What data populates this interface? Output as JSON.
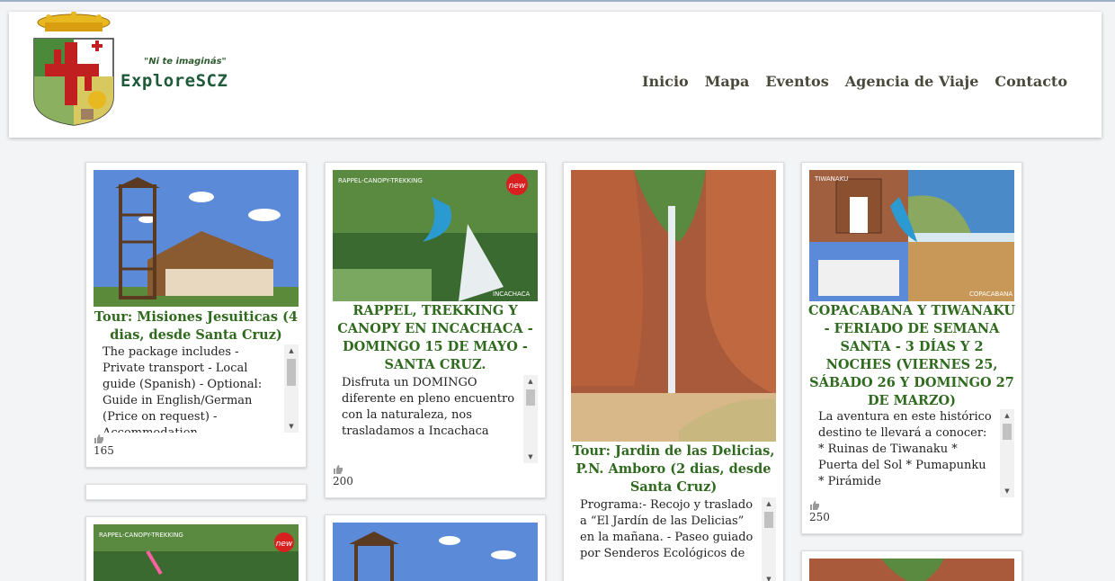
{
  "header": {
    "tagline": "\"Ni te imaginás\"",
    "brand": "ExploreSCZ",
    "nav": [
      "Inicio",
      "Mapa",
      "Eventos",
      "Agencia de Viaje",
      "Contacto"
    ]
  },
  "cards": [
    {
      "title": "Tour: Misiones Jesuiticas (4 dias, desde Santa Cruz)",
      "description": "The package includes - Private transport - Local guide (Spanish) - Optional: Guide in English/German (Price on request) - Accommodation",
      "likes": "165"
    },
    {
      "title": "RAPPEL, TREKKING Y CANOPY EN INCACHACA - DOMINGO 15 DE MAYO - SANTA CRUZ.",
      "description": "Disfruta un DOMINGO diferente en pleno encuentro con la naturaleza, nos trasladamos a Incachaca",
      "likes": "200",
      "image_labels": [
        "RAPPEL-CANOPY-TREKKING",
        "new",
        "INCACHACA"
      ]
    },
    {
      "title": "Tour: Jardin de las Delicias, P.N. Amboro (2 dias, desde Santa Cruz)",
      "description": "Programa:- Recojo y traslado a “El Jardín de las Delicias” en la mañana. - Paseo guiado por Senderos Ecológicos de",
      "likes": ""
    },
    {
      "title": "COPACABANA Y TIWANAKU - FERIADO DE SEMANA SANTA - 3 DÍAS Y 2 NOCHES (VIERNES 25, SÁBADO 26 Y DOMINGO 27 DE MARZO)",
      "description": "La aventura en este histórico destino te llevará a conocer: * Ruinas de Tiwanaku * Puerta del Sol * Pumapunku * Pirámide",
      "likes": "250",
      "image_labels": [
        "TIWANAKU",
        "COPACABANA"
      ]
    }
  ],
  "bottom_labels": [
    "RAPPEL-CANOPY-TREKKING",
    "new"
  ],
  "colors": {
    "title_green": "#2f6a1e",
    "nav_text": "#4a4a3c"
  }
}
